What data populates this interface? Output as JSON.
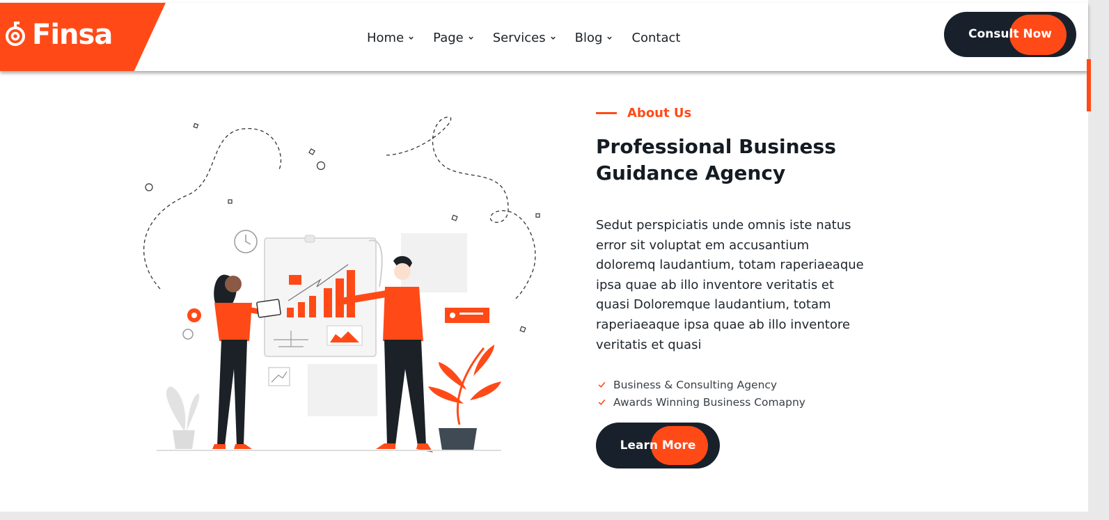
{
  "brand": {
    "name": "Finsa",
    "accent": "#ff4a17",
    "dark": "#18212b"
  },
  "nav": {
    "items": [
      {
        "label": "Home",
        "icon": "chevron-down-icon"
      },
      {
        "label": "Page",
        "icon": "chevron-down-icon"
      },
      {
        "label": "Services",
        "icon": "chevron-down-icon"
      },
      {
        "label": "Blog",
        "icon": "chevron-down-icon"
      },
      {
        "label": "Contact"
      }
    ]
  },
  "header": {
    "cta_label": "Consult Now"
  },
  "about": {
    "eyebrow": "About Us",
    "title": "Professional Business Guidance Agency",
    "body": "Sedut perspiciatis unde omnis iste natus error sit voluptat em accusantium doloremq laudantium, totam raperiaeaque ipsa quae ab illo inventore veritatis et quasi Doloremque laudantium, totam raperiaeaque ipsa quae ab illo inventore veritatis et quasi",
    "checklist": [
      {
        "text": "Business & Consulting Agency",
        "icon": "check-icon"
      },
      {
        "text": "Awards Winning Business Comapny",
        "icon": "check-icon"
      }
    ],
    "cta_label": "Learn More"
  },
  "illustration": {
    "icon": "business-presentation-illustration"
  }
}
